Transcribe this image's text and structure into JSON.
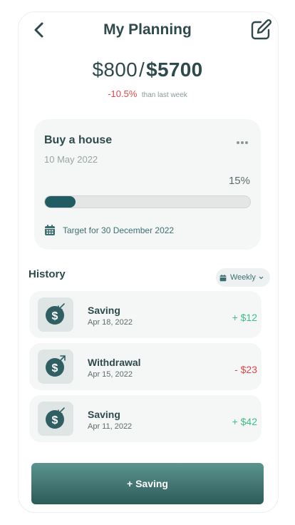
{
  "header": {
    "title": "My Planning"
  },
  "summary": {
    "spent": "$800",
    "separator": "/",
    "total": "$5700",
    "change_pct": "-10.5%",
    "change_note": "than last week"
  },
  "goal": {
    "title": "Buy a house",
    "date": "10 May 2022",
    "progress_label": "15%",
    "progress_value": 0.15,
    "target_text": "Target for 30 December 2022"
  },
  "history": {
    "title": "History",
    "filter_label": "Weekly",
    "items": [
      {
        "type": "Saving",
        "date": "Apr 18, 2022",
        "amount": "+ $12",
        "direction": "in"
      },
      {
        "type": "Withdrawal",
        "date": "Apr 15, 2022",
        "amount": "- $23",
        "direction": "out"
      },
      {
        "type": "Saving",
        "date": "Apr 11, 2022",
        "amount": "+ $42",
        "direction": "in"
      }
    ]
  },
  "action": {
    "button_label": "+ Saving"
  },
  "colors": {
    "primary": "#205c62",
    "negative": "#e2474d",
    "positive": "#3fbf86"
  }
}
